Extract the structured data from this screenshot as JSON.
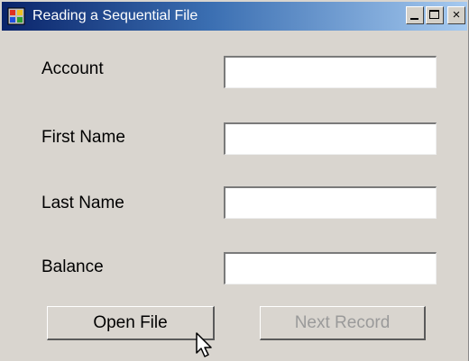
{
  "window": {
    "title": "Reading a Sequential File",
    "icons": {
      "app": "app-icon",
      "minimize": "minimize-icon",
      "maximize": "maximize-icon",
      "close": "close-icon"
    },
    "close_glyph": "×"
  },
  "form": {
    "fields": [
      {
        "label": "Account",
        "value": ""
      },
      {
        "label": "First Name",
        "value": ""
      },
      {
        "label": "Last Name",
        "value": ""
      },
      {
        "label": "Balance",
        "value": ""
      }
    ]
  },
  "buttons": {
    "open_label": "Open File",
    "next_label": "Next Record",
    "next_enabled": false
  },
  "cursor": {
    "icon": "mouse-pointer-icon"
  }
}
